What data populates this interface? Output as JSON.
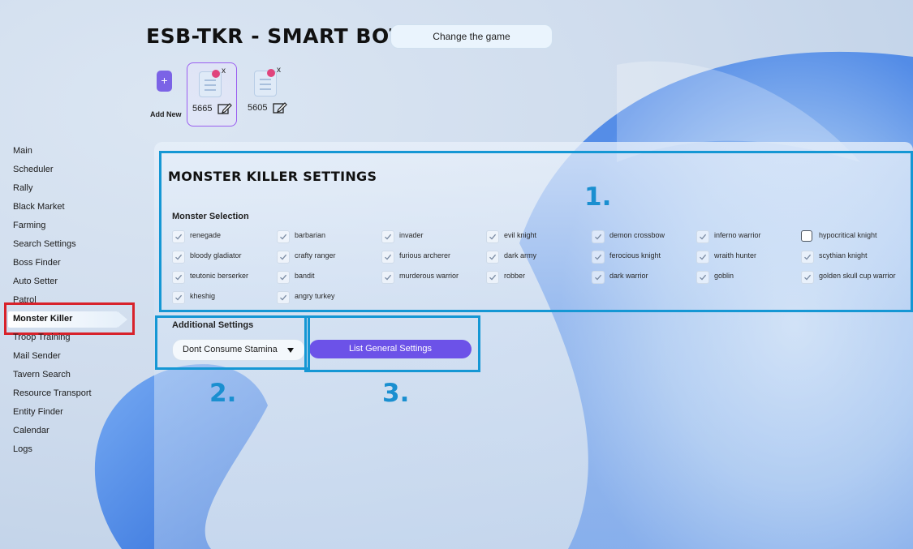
{
  "app": {
    "title": "ESB-TKR - SMART BOT",
    "change_game_label": "Change the game"
  },
  "accounts": {
    "add_symbol": "+",
    "add_label": "Add New",
    "items": [
      {
        "number": "5665",
        "remove_symbol": "x",
        "selected": true
      },
      {
        "number": "5605",
        "remove_symbol": "x",
        "selected": false
      }
    ]
  },
  "sidebar": {
    "items": [
      "Main",
      "Scheduler",
      "Rally",
      "Black Market",
      "Farming",
      "Search Settings",
      "Boss Finder",
      "Auto Setter",
      "Patrol",
      "Monster Killer",
      "Troop Training",
      "Mail Sender",
      "Tavern Search",
      "Resource Transport",
      "Entity Finder",
      "Calendar",
      "Logs"
    ],
    "active_index": 9
  },
  "monster_killer": {
    "title": "MONSTER KILLER SETTINGS",
    "monster_selection_label": "Monster Selection",
    "monsters": [
      {
        "name": "renegade",
        "checked": true
      },
      {
        "name": "barbarian",
        "checked": true
      },
      {
        "name": "invader",
        "checked": true
      },
      {
        "name": "evil knight",
        "checked": true
      },
      {
        "name": "demon crossbow",
        "checked": true
      },
      {
        "name": "inferno warrior",
        "checked": true
      },
      {
        "name": "hypocritical knight",
        "checked": false
      },
      {
        "name": "bloody gladiator",
        "checked": true
      },
      {
        "name": "crafty ranger",
        "checked": true
      },
      {
        "name": "furious archerer",
        "checked": true
      },
      {
        "name": "dark army",
        "checked": true
      },
      {
        "name": "ferocious knight",
        "checked": true
      },
      {
        "name": "wraith hunter",
        "checked": true
      },
      {
        "name": "scythian knight",
        "checked": true
      },
      {
        "name": "teutonic berserker",
        "checked": true
      },
      {
        "name": "bandit",
        "checked": true
      },
      {
        "name": "murderous warrior",
        "checked": true
      },
      {
        "name": "robber",
        "checked": true
      },
      {
        "name": "dark warrior",
        "checked": true
      },
      {
        "name": "goblin",
        "checked": true
      },
      {
        "name": "golden skull cup warrior",
        "checked": true
      },
      {
        "name": "kheshig",
        "checked": true
      },
      {
        "name": "angry turkey",
        "checked": true
      }
    ],
    "additional_settings_label": "Additional Settings",
    "stamina_selected": "Dont Consume Stamina",
    "general_settings_button": "List General Settings"
  },
  "annotations": {
    "labels": [
      "1.",
      "2.",
      "3."
    ]
  },
  "colors": {
    "accent_purple": "#6c52e8",
    "annotation_blue": "#1597d4",
    "highlight_red": "#d8222b",
    "remove_dot": "#e0447c"
  }
}
